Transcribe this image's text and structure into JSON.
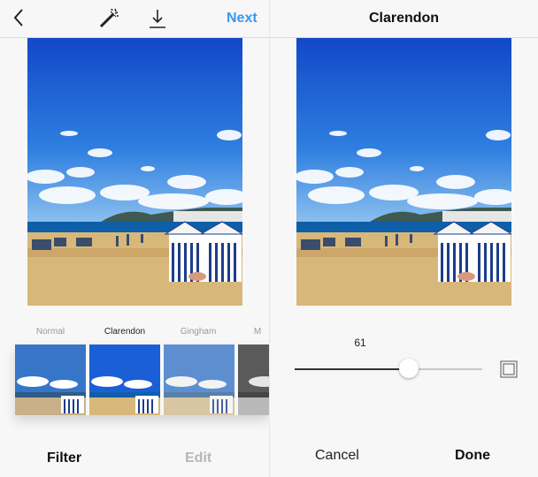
{
  "left": {
    "header": {
      "next_label": "Next"
    },
    "filters": [
      {
        "label": "Normal",
        "selected": false
      },
      {
        "label": "Clarendon",
        "selected": true
      },
      {
        "label": "Gingham",
        "selected": false
      },
      {
        "label": "M",
        "selected": false
      }
    ],
    "tabs": {
      "filter_label": "Filter",
      "edit_label": "Edit"
    }
  },
  "right": {
    "header": {
      "title": "Clarendon"
    },
    "slider": {
      "value_label": "61",
      "fraction": 0.61
    },
    "buttons": {
      "cancel_label": "Cancel",
      "done_label": "Done"
    }
  },
  "icons": [
    "chevron-left-icon",
    "magic-wand-icon",
    "download-icon",
    "frame-icon"
  ],
  "colors": {
    "accent": "#3897f0",
    "sky": "#1b5fd6",
    "sand": "#d8b77a",
    "disabled": "#b7b7b7"
  }
}
